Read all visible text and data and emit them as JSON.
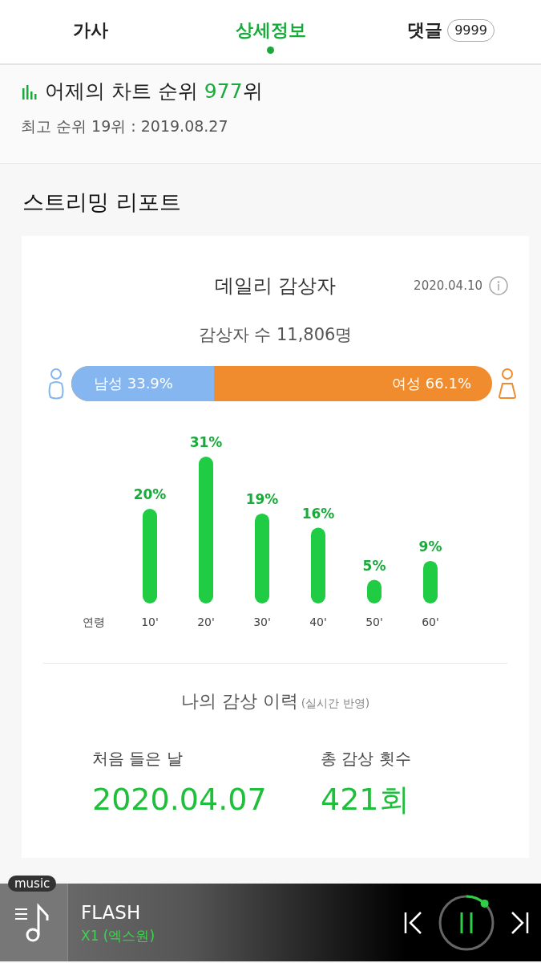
{
  "tabs": [
    {
      "label": "가사",
      "selected": false
    },
    {
      "label": "상세정보",
      "selected": true
    },
    {
      "label": "댓글",
      "badge": "9999",
      "selected": false
    }
  ],
  "chart_rank": {
    "text": "어제의 차트 순위 **977**위",
    "best": "최고 순위 19위 : 2019.08.27"
  },
  "report": {
    "heading": "스트리밍 리포트",
    "title": "데일리 감상자",
    "date": "2020.04.10",
    "listeners": "감상자 수 11,806명",
    "gender": {
      "male_label": "남성 33.9%",
      "female_label": "여성 66.1%",
      "level": 0.339
    },
    "chart_data": {
      "type": "bar",
      "xlabel": "연령",
      "categories": [
        "10'",
        "20'",
        "30'",
        "40'",
        "50'",
        "60'"
      ],
      "values": [
        20,
        31,
        19,
        16,
        5,
        9
      ],
      "value_labels": [
        "20%",
        "31%",
        "19%",
        "16%",
        "5%",
        "9%"
      ]
    },
    "history": {
      "title": "나의 감상 이력",
      "note": "(실시간 반영)",
      "first_label": "처음 들은 날",
      "first_value": "2020.04.07",
      "count_label": "총 감상 횟수",
      "count_value": "421회"
    }
  },
  "player": {
    "badge": "music",
    "title": "FLASH",
    "artist": "X1 (엑스원)",
    "playing": true,
    "level": 0.12
  }
}
